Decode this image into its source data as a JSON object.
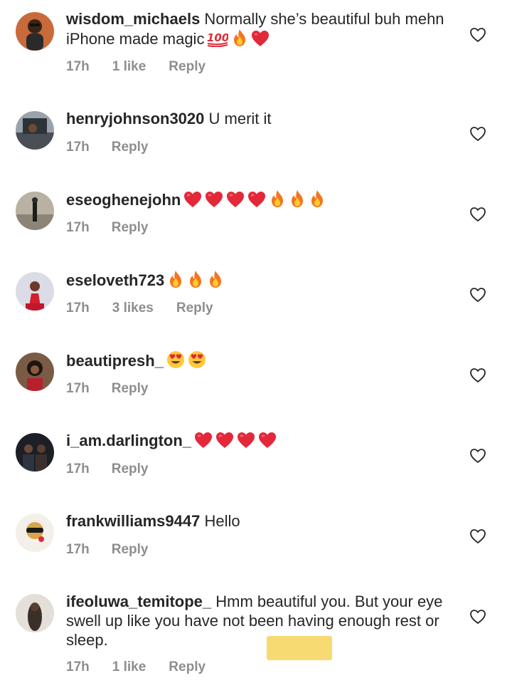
{
  "colors": {
    "text": "#262626",
    "meta": "#8e8e8e",
    "heart": "#e3283a",
    "highlight": "#f7d35a"
  },
  "comments": [
    {
      "user": "wisdom_michaels",
      "text": "Normally she’s beautiful buh mehn iPhone made magic",
      "emojis": [
        "hundred-points",
        "fire",
        "red-heart"
      ],
      "time": "17h",
      "likes": "1 like",
      "reply": "Reply"
    },
    {
      "user": "henryjohnson3020",
      "text": "U merit it",
      "emojis": [],
      "time": "17h",
      "likes": "",
      "reply": "Reply"
    },
    {
      "user": "eseoghenejohn",
      "text": "",
      "emojis": [
        "red-heart",
        "red-heart",
        "red-heart",
        "red-heart",
        "fire",
        "fire",
        "fire"
      ],
      "time": "17h",
      "likes": "",
      "reply": "Reply"
    },
    {
      "user": "eseloveth723",
      "text": "",
      "emojis": [
        "fire",
        "fire",
        "fire"
      ],
      "time": "17h",
      "likes": "3 likes",
      "reply": "Reply"
    },
    {
      "user": "beautipresh_",
      "text": "",
      "emojis": [
        "heart-eyes",
        "heart-eyes"
      ],
      "time": "17h",
      "likes": "",
      "reply": "Reply"
    },
    {
      "user": "i_am.darlington_",
      "text": "",
      "emojis": [
        "red-heart",
        "red-heart",
        "red-heart",
        "red-heart"
      ],
      "time": "17h",
      "likes": "",
      "reply": "Reply"
    },
    {
      "user": "frankwilliams9447",
      "text": "Hello",
      "emojis": [],
      "time": "17h",
      "likes": "",
      "reply": "Reply"
    },
    {
      "user": "ifeoluwa_temitope_",
      "text": "Hmm beautiful you. But your eye swell up like you have not been having enough rest or sleep.",
      "emojis": [],
      "time": "17h",
      "likes": "1 like",
      "reply": "Reply"
    }
  ]
}
